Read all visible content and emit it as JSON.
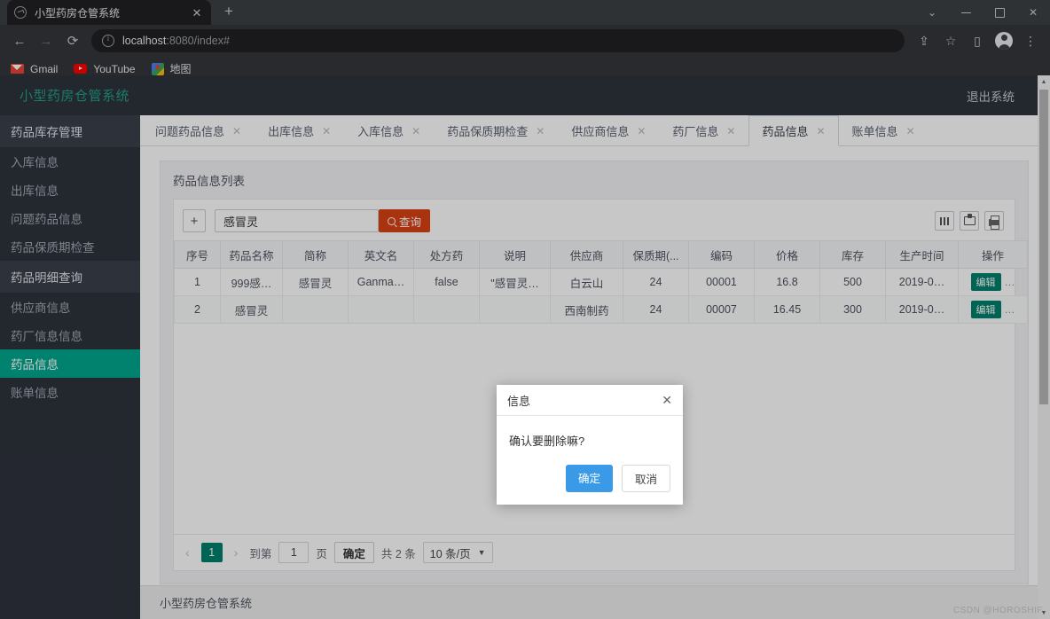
{
  "browser": {
    "tab_title": "小型药房仓管系统",
    "tab_close": "✕",
    "new_tab": "+",
    "back": "←",
    "forward": "→",
    "reload": "⟳",
    "url_host": "localhost",
    "url_rest": ":8080/index#",
    "window_minimize": "–",
    "window_maximize": "□",
    "window_close": "✕",
    "window_chevron": "⌄",
    "share_icon": "⇪",
    "star_icon": "☆",
    "sidepanel_icon": "▯",
    "menu_icon": "⋮",
    "bookmarks": [
      {
        "label": "Gmail",
        "icon": "gmail-icon"
      },
      {
        "label": "YouTube",
        "icon": "youtube-icon"
      },
      {
        "label": "地图",
        "icon": "maps-icon"
      }
    ]
  },
  "header": {
    "brand": "小型药房仓管系统",
    "logout": "退出系统"
  },
  "sidebar": {
    "items": [
      {
        "label": "药品库存管理",
        "type": "group"
      },
      {
        "label": "入库信息",
        "type": "item"
      },
      {
        "label": "出库信息",
        "type": "item"
      },
      {
        "label": "问题药品信息",
        "type": "item"
      },
      {
        "label": "药品保质期检查",
        "type": "item"
      },
      {
        "label": "药品明细查询",
        "type": "group"
      },
      {
        "label": "供应商信息",
        "type": "item"
      },
      {
        "label": "药厂信息信息",
        "type": "item"
      },
      {
        "label": "药品信息",
        "type": "item",
        "active": true
      },
      {
        "label": "账单信息",
        "type": "item"
      }
    ]
  },
  "tabs": [
    {
      "label": "问题药品信息",
      "active": false
    },
    {
      "label": "出库信息",
      "active": false
    },
    {
      "label": "入库信息",
      "active": false
    },
    {
      "label": "药品保质期检查",
      "active": false
    },
    {
      "label": "供应商信息",
      "active": false
    },
    {
      "label": "药厂信息",
      "active": false
    },
    {
      "label": "药品信息",
      "active": true
    },
    {
      "label": "账单信息",
      "active": false
    }
  ],
  "tab_close_glyph": "✕",
  "panel": {
    "title": "药品信息列表"
  },
  "toolbar": {
    "add_label": "+",
    "search_value": "感冒灵",
    "search_placeholder": "",
    "search_button": "查询",
    "columns_icon": "columns-icon",
    "export_icon": "export-icon",
    "print_icon": "print-icon"
  },
  "table": {
    "headers": [
      "序号",
      "药品名称",
      "简称",
      "英文名",
      "处方药",
      "说明",
      "供应商",
      "保质期(...",
      "编码",
      "价格",
      "库存",
      "生产时间",
      "操作"
    ],
    "rows": [
      {
        "序号": "1",
        "药品名称": "999感…",
        "简称": "感冒灵",
        "英文名": "Ganma…",
        "处方药": "false",
        "说明": "\"感冒灵…",
        "供应商": "白云山",
        "保质期": "24",
        "编码": "00001",
        "价格": "16.8",
        "库存": "500",
        "生产时间": "2019-0…",
        "操作": "编辑",
        "操作_more": "…"
      },
      {
        "序号": "2",
        "药品名称": "感冒灵",
        "简称": "",
        "英文名": "",
        "处方药": "",
        "说明": "",
        "供应商": "西南制药",
        "保质期": "24",
        "编码": "00007",
        "价格": "16.45",
        "库存": "300",
        "生产时间": "2019-0…",
        "操作": "编辑",
        "操作_more": "…"
      }
    ]
  },
  "pagination": {
    "prev": "‹",
    "next": "›",
    "current_page": "1",
    "goto_label": "到第",
    "goto_value": "1",
    "page_unit": "页",
    "confirm": "确定",
    "total": "共 2 条",
    "page_size": "10 条/页",
    "caret": "▼"
  },
  "footer": {
    "text": "小型药房仓管系统"
  },
  "modal": {
    "title": "信息",
    "close": "✕",
    "message": "确认要删除嘛?",
    "ok": "确定",
    "cancel": "取消"
  },
  "watermark": "CSDN @HOROSHIF",
  "scrollbar": {
    "up": "▲",
    "down": "▼"
  }
}
